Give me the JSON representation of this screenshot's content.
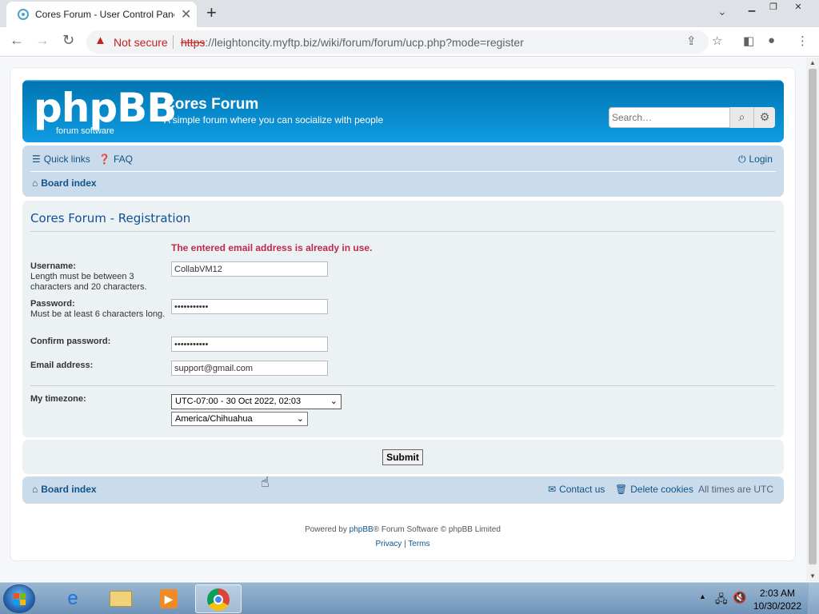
{
  "browser": {
    "tab_title": "Cores Forum - User Control Panel",
    "security_label": "Not secure",
    "url_scheme": "https",
    "url_rest": "://leightoncity.myftp.biz/wiki/forum/forum/ucp.php?mode=register"
  },
  "header": {
    "logo_text": "phpBB",
    "logo_sub": "forum  software",
    "site_name": "Cores Forum",
    "site_desc": "A simple forum where you can socialize with people",
    "search_placeholder": "Search…"
  },
  "navbar": {
    "quick_links": "Quick links",
    "faq": "FAQ",
    "login": "Login",
    "board_index": "Board index"
  },
  "form": {
    "title": "Cores Forum - Registration",
    "error": "The entered email address is already in use.",
    "username_label": "Username:",
    "username_explain": "Length must be between 3 characters and 20 characters.",
    "username_value": "CollabVM12",
    "password_label": "Password:",
    "password_explain": "Must be at least 6 characters long.",
    "password_value": "•••••••••••",
    "confirm_label": "Confirm password:",
    "confirm_value": "•••••••••••",
    "email_label": "Email address:",
    "email_value": "support@gmail.com",
    "timezone_label": "My timezone:",
    "timezone_offset": "UTC-07:00 - 30 Oct 2022, 02:03",
    "timezone_zone": "America/Chihuahua",
    "submit_label": "Submit"
  },
  "footer": {
    "board_index": "Board index",
    "contact": "Contact us",
    "delete_cookies": "Delete cookies",
    "timezone_note": "All times are UTC",
    "powered_prefix": "Powered by ",
    "phpbb_link": "phpBB",
    "powered_mid": "® Forum Software © phpBB Limited",
    "privacy": "Privacy",
    "sep": "|",
    "terms": "Terms"
  },
  "taskbar": {
    "time": "2:03 AM",
    "date": "10/30/2022"
  },
  "colors": {
    "header_blue": "#12a3eb",
    "nav_blue": "#cadceb",
    "link_blue": "#105289",
    "error_red": "#bc2a4d"
  }
}
